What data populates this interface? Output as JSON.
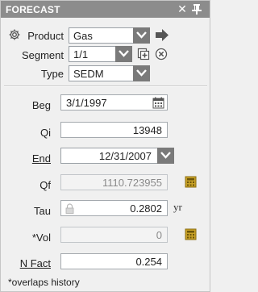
{
  "window": {
    "title": "FORECAST",
    "close_glyph": "✕"
  },
  "product": {
    "label": "Product",
    "value": "Gas"
  },
  "segment": {
    "label": "Segment",
    "value": "1/1"
  },
  "type": {
    "label": "Type",
    "value": "SEDM"
  },
  "beg": {
    "label": "Beg",
    "value": "3/1/1997"
  },
  "qi": {
    "label": "Qi",
    "value": "13948"
  },
  "end": {
    "label": "End",
    "value": "12/31/2007"
  },
  "qf": {
    "label": "Qf",
    "value": "1110.723955"
  },
  "tau": {
    "label": "Tau",
    "value": "0.2802",
    "unit": "yr"
  },
  "vol": {
    "label": "*Vol",
    "value": "0"
  },
  "nfact": {
    "label": "N Fact",
    "value": "0.254"
  },
  "footnote": "*overlaps history",
  "colors": {
    "titlebar": "#8c8c8c",
    "dropdown_arrow_bg": "#7a7a7a",
    "calc_icon": "#c9a227",
    "nav_arrow": "#555555"
  }
}
